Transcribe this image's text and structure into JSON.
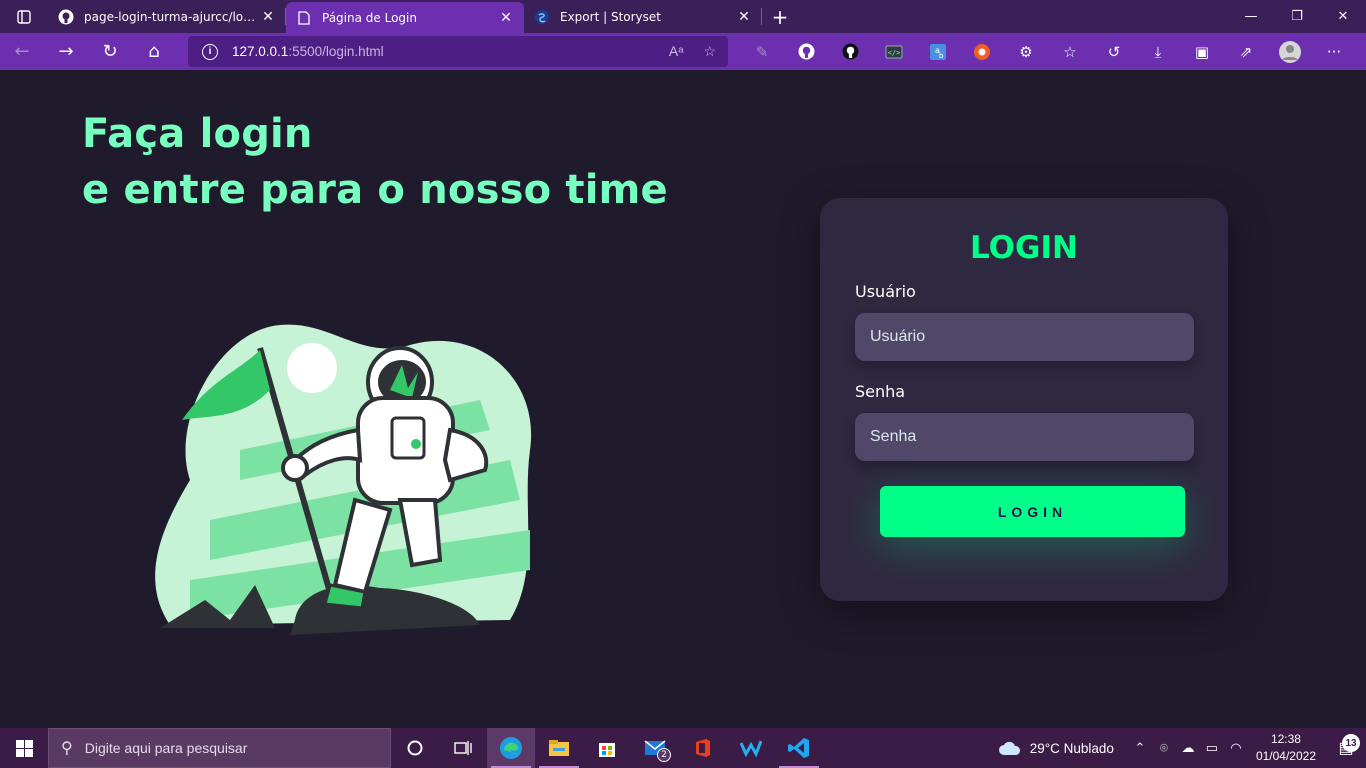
{
  "browser": {
    "tabs": [
      {
        "title": "page-login-turma-ajurcc/login.css",
        "icon": "github-icon"
      },
      {
        "title": "Página de Login",
        "icon": "page-icon",
        "active": true
      },
      {
        "title": "Export | Storyset",
        "icon": "storyset-icon"
      }
    ],
    "url_host": "127.0.0.1",
    "url_path": ":5500/login.html"
  },
  "page": {
    "headline_line1": "Faça login",
    "headline_line2": "e entre para o nosso time",
    "login": {
      "title": "LOGIN",
      "user_label": "Usuário",
      "user_placeholder": "Usuário",
      "password_label": "Senha",
      "password_placeholder": "Senha",
      "button_label": "LOGIN"
    },
    "colors": {
      "accent": "#00ff88",
      "headline": "#77ffc0",
      "background": "#201b2c",
      "card": "#2f2841",
      "input": "#514869"
    }
  },
  "taskbar": {
    "search_placeholder": "Digite aqui para pesquisar",
    "mail_badge": "2",
    "weather": "29°C  Nublado",
    "time": "12:38",
    "date": "01/04/2022",
    "notifications": "13"
  }
}
